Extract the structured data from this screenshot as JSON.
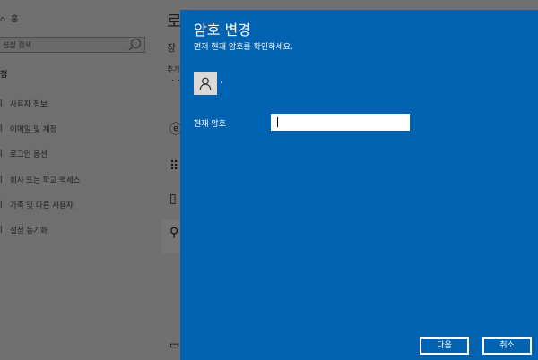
{
  "sidebar": {
    "home": "홈",
    "search_placeholder": "설정 검색",
    "section": "정",
    "items": [
      {
        "label": "사용자 정보",
        "icon": "person-icon"
      },
      {
        "label": "이메일 및 계정",
        "icon": "mail-icon"
      },
      {
        "label": "로그인 옵션",
        "icon": "key-icon"
      },
      {
        "label": "회사 또는 학교 액세스",
        "icon": "briefcase-icon"
      },
      {
        "label": "가족 및 다른 사용자",
        "icon": "family-icon"
      },
      {
        "label": "설정 동기화",
        "icon": "sync-icon"
      }
    ]
  },
  "background": {
    "title": "로",
    "subtitle": "장",
    "small_label": "추가"
  },
  "dialog": {
    "title": "암호 변경",
    "subtitle": "먼저 현재 암호를 확인하세요.",
    "password_label": "현재 암호",
    "password_value": "",
    "next_label": "다음",
    "cancel_label": "취소",
    "accent_color": "#0063b1"
  }
}
